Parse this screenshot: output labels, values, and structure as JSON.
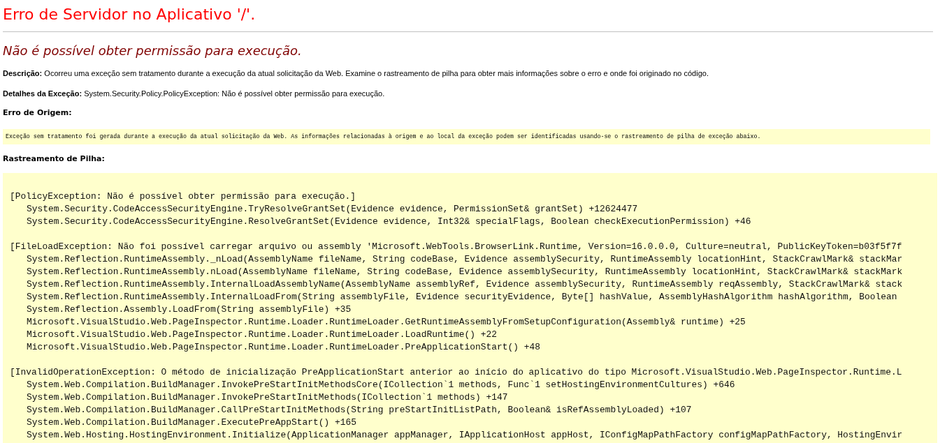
{
  "title": "Erro de Servidor no Aplicativo '/'.",
  "subtitle": "Não é possível obter permissão para execução.",
  "description": {
    "label": "Descrição:",
    "text": "Ocorreu uma exceção sem tratamento durante a execução da atual solicitação da Web. Examine o rastreamento de pilha para obter mais informações sobre o erro e onde foi originado no código."
  },
  "exception_details": {
    "label": "Detalhes da Exceção:",
    "text": "System.Security.Policy.PolicyException: Não é possível obter permissão para execução."
  },
  "source_error": {
    "label": "Erro de Origem:",
    "text": "Exceção sem tratamento foi gerada durante a execução da atual solicitação da Web. As informações relacionadas à origem e ao local da exceção podem ser identificadas usando-se o rastreamento de pilha de exceção abaixo."
  },
  "stack_trace": {
    "label": "Rastreamento de Pilha:",
    "blocks": [
      {
        "header": "[PolicyException: Não é possível obter permissão para execução.]",
        "frames": [
          "System.Security.CodeAccessSecurityEngine.TryResolveGrantSet(Evidence evidence, PermissionSet& grantSet) +12624477",
          "System.Security.CodeAccessSecurityEngine.ResolveGrantSet(Evidence evidence, Int32& specialFlags, Boolean checkExecutionPermission) +46"
        ]
      },
      {
        "header": "[FileLoadException: Não foi possível carregar arquivo ou assembly 'Microsoft.WebTools.BrowserLink.Runtime, Version=16.0.0.0, Culture=neutral, PublicKeyToken=b03f5f7f",
        "frames": [
          "System.Reflection.RuntimeAssembly._nLoad(AssemblyName fileName, String codeBase, Evidence assemblySecurity, RuntimeAssembly locationHint, StackCrawlMark& stackMar",
          "System.Reflection.RuntimeAssembly.nLoad(AssemblyName fileName, String codeBase, Evidence assemblySecurity, RuntimeAssembly locationHint, StackCrawlMark& stackMark",
          "System.Reflection.RuntimeAssembly.InternalLoadAssemblyName(AssemblyName assemblyRef, Evidence assemblySecurity, RuntimeAssembly reqAssembly, StackCrawlMark& stack",
          "System.Reflection.RuntimeAssembly.InternalLoadFrom(String assemblyFile, Evidence securityEvidence, Byte[] hashValue, AssemblyHashAlgorithm hashAlgorithm, Boolean",
          "System.Reflection.Assembly.LoadFrom(String assemblyFile) +35",
          "Microsoft.VisualStudio.Web.PageInspector.Runtime.Loader.RuntimeLoader.GetRuntimeAssemblyFromSetupConfiguration(Assembly& runtime) +25",
          "Microsoft.VisualStudio.Web.PageInspector.Runtime.Loader.RuntimeLoader.LoadRuntime() +22",
          "Microsoft.VisualStudio.Web.PageInspector.Runtime.Loader.RuntimeLoader.PreApplicationStart() +48"
        ]
      },
      {
        "header": "[InvalidOperationException: O método de inicialização PreApplicationStart anterior ao início do aplicativo do tipo Microsoft.VisualStudio.Web.PageInspector.Runtime.L",
        "frames": [
          "System.Web.Compilation.BuildManager.InvokePreStartInitMethodsCore(ICollection`1 methods, Func`1 setHostingEnvironmentCultures) +646",
          "System.Web.Compilation.BuildManager.InvokePreStartInitMethods(ICollection`1 methods) +147",
          "System.Web.Compilation.BuildManager.CallPreStartInitMethods(String preStartInitListPath, Boolean& isRefAssemblyLoaded) +107",
          "System.Web.Compilation.BuildManager.ExecutePreAppStart() +165",
          "System.Web.Hosting.HostingEnvironment.Initialize(ApplicationManager appManager, IApplicationHost appHost, IConfigMapPathFactory configMapPathFactory, HostingEnvir"
        ]
      }
    ]
  }
}
